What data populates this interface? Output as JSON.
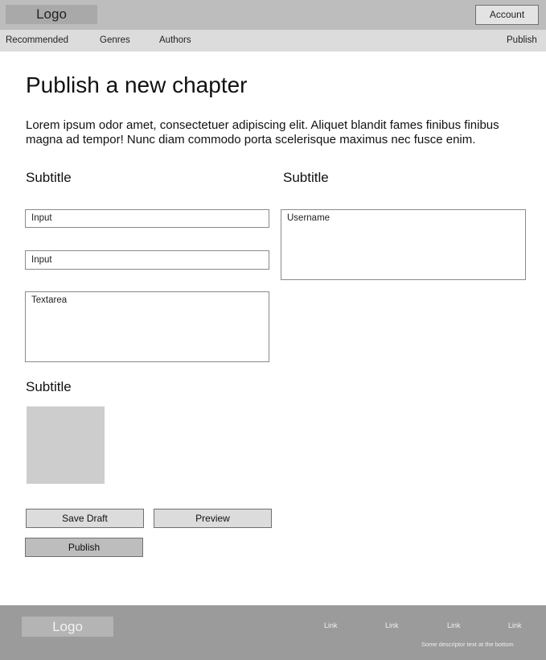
{
  "header": {
    "logo": "Logo",
    "account_label": "Account"
  },
  "nav": {
    "items": [
      "Recommended",
      "Genres",
      "Authors"
    ],
    "publish_label": "Publish"
  },
  "main": {
    "title": "Publish a new chapter",
    "intro": "Lorem ipsum odor amet, consectetuer adipiscing elit. Aliquet blandit fames finibus finibus magna ad tempor! Nunc diam commodo porta scelerisque maximus nec fusce enim.",
    "left_subtitle": "Subtitle",
    "right_subtitle": "Subtitle",
    "image_subtitle": "Subtitle",
    "input1_value": "Input",
    "input2_value": "Input",
    "textarea_value": "Textarea",
    "username_value": "Username",
    "save_draft_label": "Save Draft",
    "preview_label": "Preview",
    "publish_label": "Publish"
  },
  "footer": {
    "logo": "Logo",
    "links": [
      "Link",
      "Link",
      "Link",
      "Link"
    ],
    "descriptor": "Some descriptor text at the bottom"
  }
}
